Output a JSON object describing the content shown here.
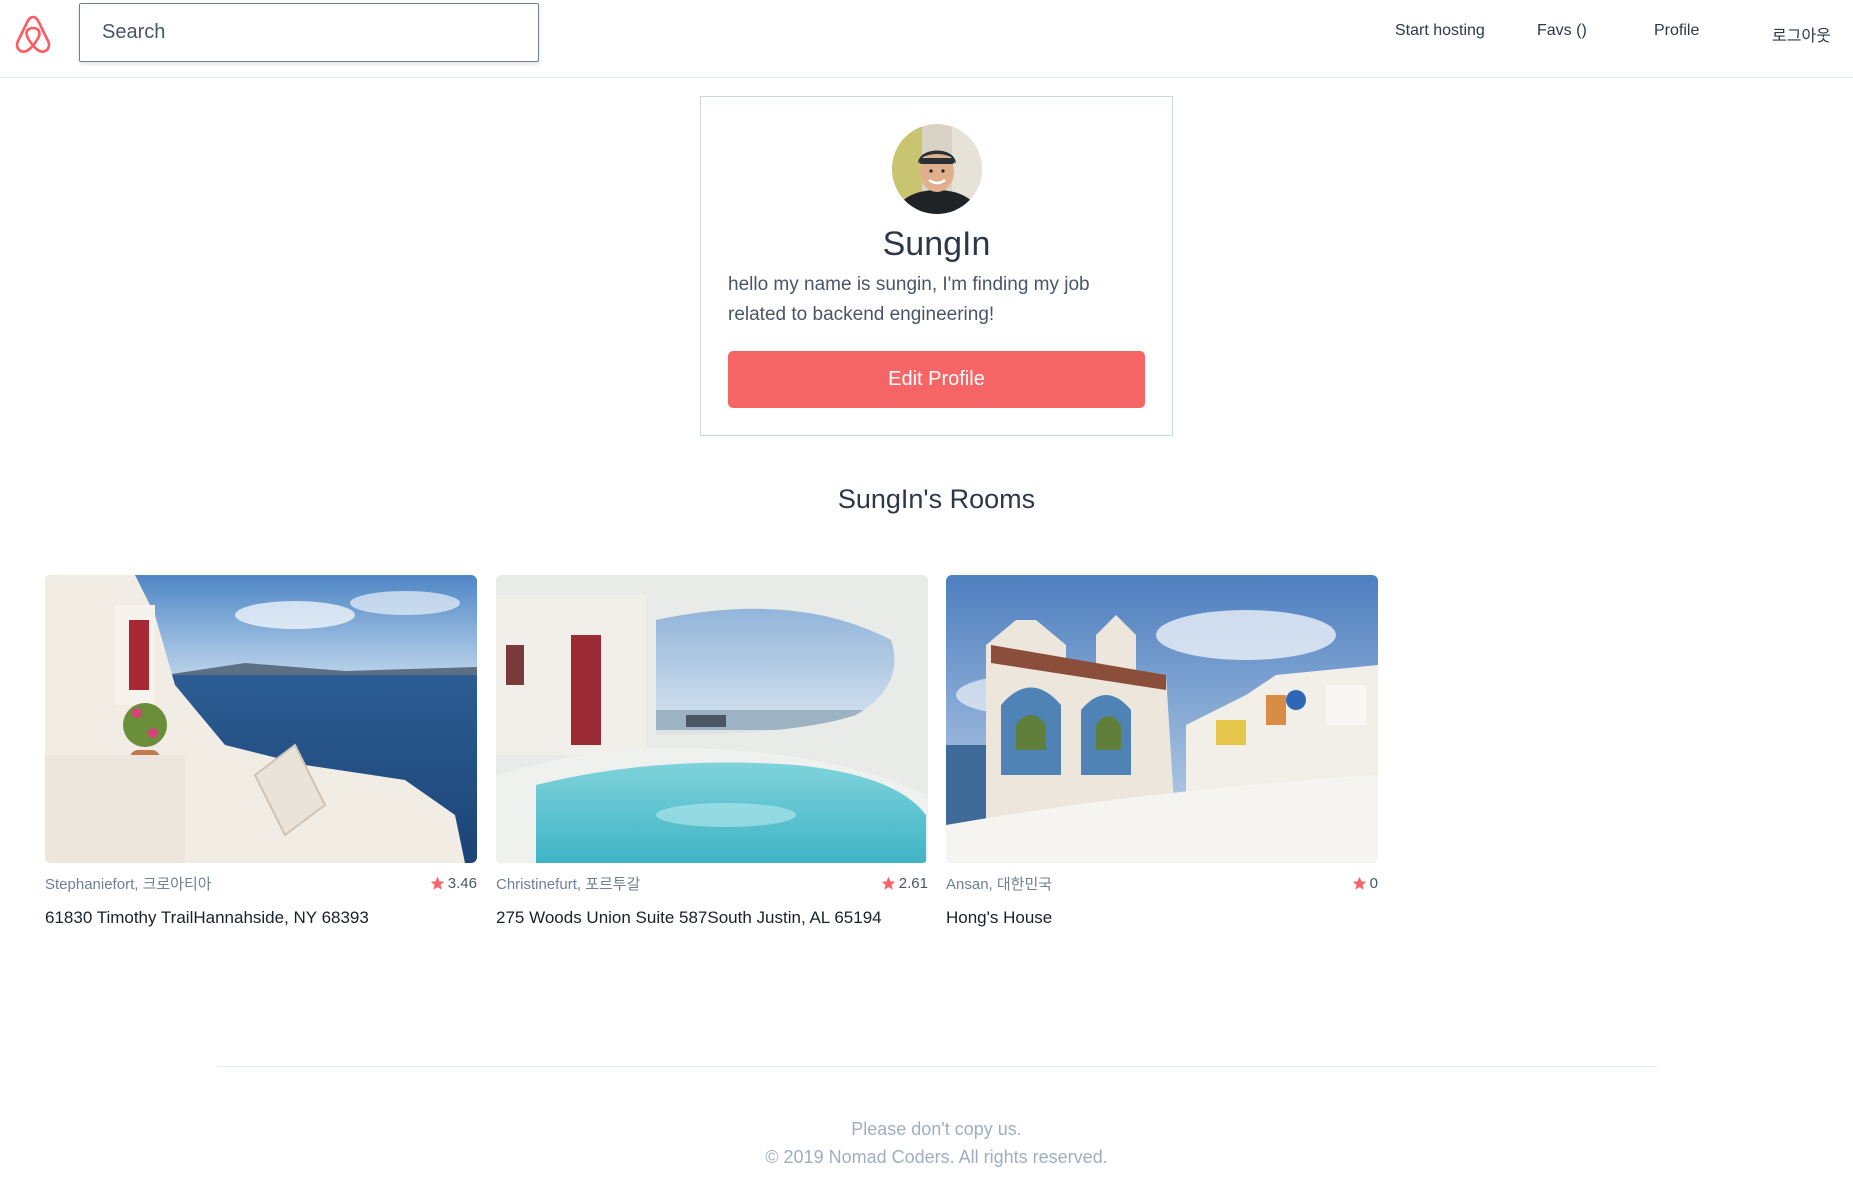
{
  "header": {
    "search_placeholder": "Search",
    "nav": {
      "start_hosting": "Start hosting",
      "favs": "Favs ()",
      "profile": "Profile",
      "logout": "로그아웃"
    },
    "logo_icon": "airbnb-logo-icon",
    "brand_color": "#ff5a5f"
  },
  "profile": {
    "name": "SungIn",
    "bio": "hello my name is sungin, I'm finding my job related to backend engineering!",
    "edit_button": "Edit Profile",
    "button_color": "#f56565"
  },
  "rooms_title": "SungIn's Rooms",
  "rooms": [
    {
      "location": "Stephaniefort, 크로아티아",
      "rating": "3.46",
      "name": "61830 Timothy TrailHannahside, NY 68393"
    },
    {
      "location": "Christinefurt, 포르투갈",
      "rating": "2.61",
      "name": "275 Woods Union Suite 587South Justin, AL 65194"
    },
    {
      "location": "Ansan, 대한민국",
      "rating": "0",
      "name": "Hong's House"
    }
  ],
  "footer": {
    "line1": "Please don't copy us.",
    "line2": "© 2019 Nomad Coders. All rights reserved."
  }
}
